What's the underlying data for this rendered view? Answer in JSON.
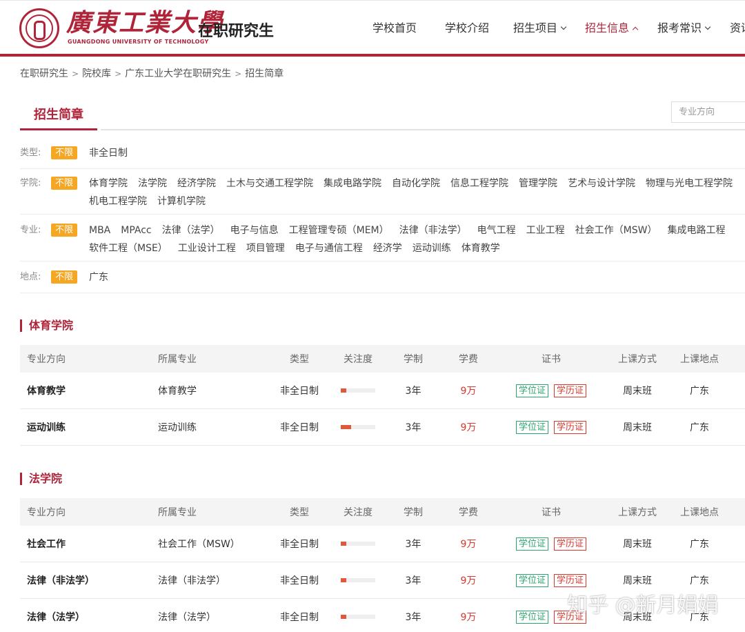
{
  "header": {
    "logo_cn": "廣東工業大學",
    "logo_en": "GUANGDONG UNIVERSITY OF TECHNOLOGY",
    "site_title": "在职研究生",
    "nav": [
      {
        "label": "学校首页"
      },
      {
        "label": "学校介绍"
      },
      {
        "label": "招生项目"
      },
      {
        "label": "招生信息"
      },
      {
        "label": "报考常识"
      },
      {
        "label": "资讯"
      }
    ],
    "accent": "#b0243a"
  },
  "breadcrumb": [
    "在职研究生",
    "院校库",
    "广东工业大学在职研究生",
    "招生简章"
  ],
  "section": {
    "tab": "招生简章",
    "search_placeholder": "专业方向"
  },
  "filters": {
    "badge": "不限",
    "type": {
      "label": "类型:",
      "options": [
        "非全日制"
      ]
    },
    "college": {
      "label": "学院:",
      "options": [
        "体育学院",
        "法学院",
        "经济学院",
        "土木与交通工程学院",
        "集成电路学院",
        "自动化学院",
        "信息工程学院",
        "管理学院",
        "艺术与设计学院",
        "物理与光电工程学院",
        "机电工程学院",
        "计算机学院"
      ]
    },
    "major": {
      "label": "专业:",
      "options": [
        "MBA",
        "MPAcc",
        "法律（法学）",
        "电子与信息",
        "工程管理专硕（MEM）",
        "法律（非法学）",
        "电气工程",
        "工业工程",
        "社会工作（MSW）",
        "集成电路工程",
        "软件工程（MSE）",
        "工业设计工程",
        "项目管理",
        "电子与通信工程",
        "经济学",
        "运动训练",
        "体育教学"
      ]
    },
    "location": {
      "label": "地点:",
      "options": [
        "广东"
      ]
    }
  },
  "table_headers": [
    "专业方向",
    "所属专业",
    "类型",
    "关注度",
    "学制",
    "学费",
    "证书",
    "上课方式",
    "上课地点"
  ],
  "cert_labels": {
    "degree": "学位证",
    "education": "学历证"
  },
  "colleges": [
    {
      "name": "体育学院",
      "rows": [
        {
          "direction": "体育教学",
          "major": "体育教学",
          "type": "非全日制",
          "attention": 0.15,
          "duration": "3年",
          "fee": "9万",
          "mode": "周末班",
          "location": "广东"
        },
        {
          "direction": "运动训练",
          "major": "运动训练",
          "type": "非全日制",
          "attention": 0.3,
          "duration": "3年",
          "fee": "9万",
          "mode": "周末班",
          "location": "广东"
        }
      ]
    },
    {
      "name": "法学院",
      "rows": [
        {
          "direction": "社会工作",
          "major": "社会工作（MSW）",
          "type": "非全日制",
          "attention": 0.15,
          "duration": "3年",
          "fee": "9万",
          "mode": "周末班",
          "location": "广东"
        },
        {
          "direction": "法律（非法学）",
          "major": "法律（非法学）",
          "type": "非全日制",
          "attention": 0.15,
          "duration": "3年",
          "fee": "9万",
          "mode": "周末班",
          "location": "广东"
        },
        {
          "direction": "法律（法学）",
          "major": "法律（法学）",
          "type": "非全日制",
          "attention": 0.15,
          "duration": "3年",
          "fee": "9万",
          "mode": "周末班",
          "location": "广东"
        }
      ]
    }
  ],
  "watermark": "知乎 @新月娟娟"
}
